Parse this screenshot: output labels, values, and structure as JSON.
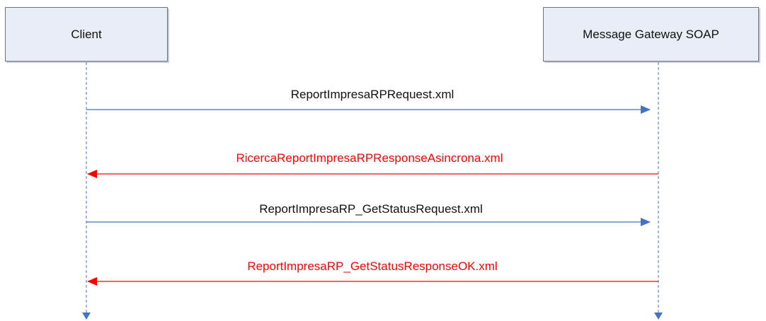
{
  "actors": {
    "client": {
      "label": "Client"
    },
    "gateway": {
      "label": "Message Gateway SOAP"
    }
  },
  "messages": [
    {
      "label": "ReportImpresaRPRequest.xml",
      "direction": "client-to-gateway",
      "color": "#4472c4",
      "text_color": "#111111"
    },
    {
      "label": "RicercaReportImpresaRPResponseAsincrona.xml",
      "direction": "gateway-to-client",
      "color": "#ff0000",
      "text_color": "#ff0000"
    },
    {
      "label": "ReportImpresaRP_GetStatusRequest.xml",
      "direction": "client-to-gateway",
      "color": "#4472c4",
      "text_color": "#111111"
    },
    {
      "label": "ReportImpresaRP_GetStatusResponseOK.xml",
      "direction": "gateway-to-client",
      "color": "#ff0000",
      "text_color": "#ff0000"
    }
  ],
  "colors": {
    "lifeline": "#4472c4",
    "request": "#4472c4",
    "response": "#ff0000"
  }
}
